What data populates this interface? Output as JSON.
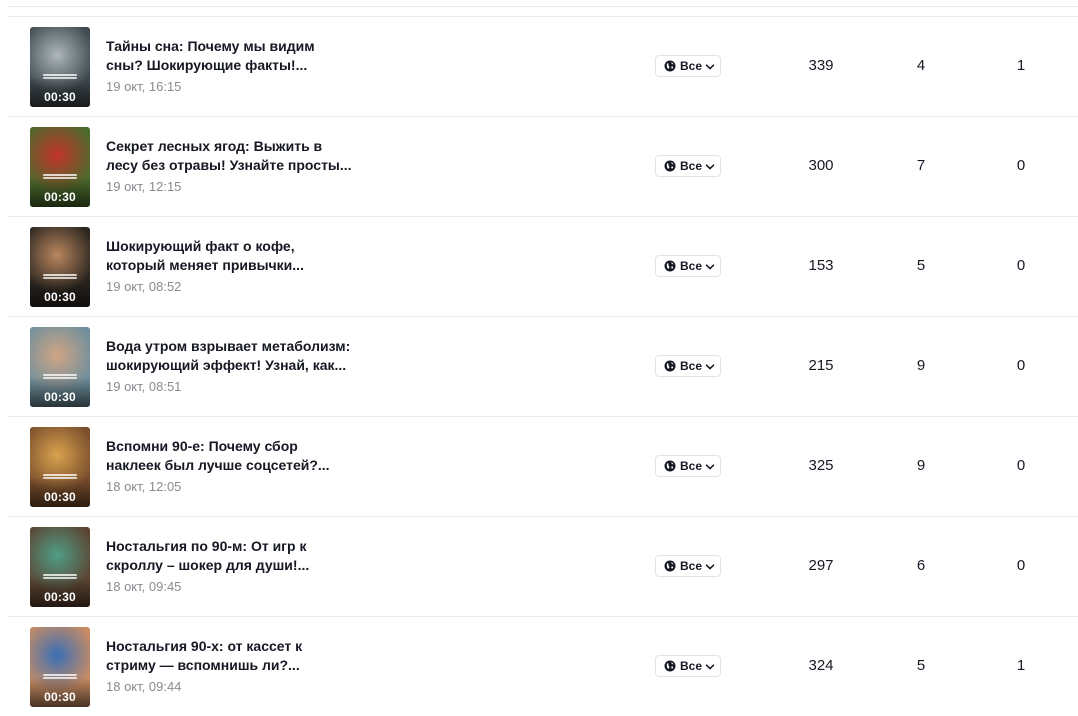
{
  "videos": [
    {
      "title_line1": "Тайны сна: Почему мы видим",
      "title_line2": "сны? Шокирующие факты!...",
      "date": "19 окт, 16:15",
      "duration": "00:30",
      "privacy": "Все",
      "views": "339",
      "likes": "4",
      "comments": "1",
      "thumb_bg": "#3f4a50",
      "thumb_accent": "#aeb7ba"
    },
    {
      "title_line1": "Секрет лесных ягод: Выжить в",
      "title_line2": "лесу без отравы! Узнайте просты...",
      "date": "19 окт, 12:15",
      "duration": "00:30",
      "privacy": "Все",
      "views": "300",
      "likes": "7",
      "comments": "0",
      "thumb_bg": "#4a6b2c",
      "thumb_accent": "#c3342c"
    },
    {
      "title_line1": "Шокирующий факт о кофе,",
      "title_line2": "который меняет привычки...",
      "date": "19 окт, 08:52",
      "duration": "00:30",
      "privacy": "Все",
      "views": "153",
      "likes": "5",
      "comments": "0",
      "thumb_bg": "#2c2620",
      "thumb_accent": "#b9875e"
    },
    {
      "title_line1": "Вода утром взрывает метаболизм:",
      "title_line2": "шокирующий эффект! Узнай, как...",
      "date": "19 окт, 08:51",
      "duration": "00:30",
      "privacy": "Все",
      "views": "215",
      "likes": "9",
      "comments": "0",
      "thumb_bg": "#6f8f9c",
      "thumb_accent": "#d0a585"
    },
    {
      "title_line1": "Вспомни 90-е: Почему сбор",
      "title_line2": "наклеек был лучше соцсетей?...",
      "date": "18 окт, 12:05",
      "duration": "00:30",
      "privacy": "Все",
      "views": "325",
      "likes": "9",
      "comments": "0",
      "thumb_bg": "#7a4e2c",
      "thumb_accent": "#d9a24e"
    },
    {
      "title_line1": "Ностальгия по 90-м: От игр к",
      "title_line2": "скроллу – шокер для души!...",
      "date": "18 окт, 09:45",
      "duration": "00:30",
      "privacy": "Все",
      "views": "297",
      "likes": "6",
      "comments": "0",
      "thumb_bg": "#5c4432",
      "thumb_accent": "#4f9e86"
    },
    {
      "title_line1": "Ностальгия 90-х: от кассет к",
      "title_line2": "стриму — вспомнишь ли?...",
      "date": "18 окт, 09:44",
      "duration": "00:30",
      "privacy": "Все",
      "views": "324",
      "likes": "5",
      "comments": "1",
      "thumb_bg": "#c98c63",
      "thumb_accent": "#3a6fb5"
    }
  ],
  "icons": {
    "privacy": "globe-icon",
    "dropdown": "chevron-down-icon"
  }
}
